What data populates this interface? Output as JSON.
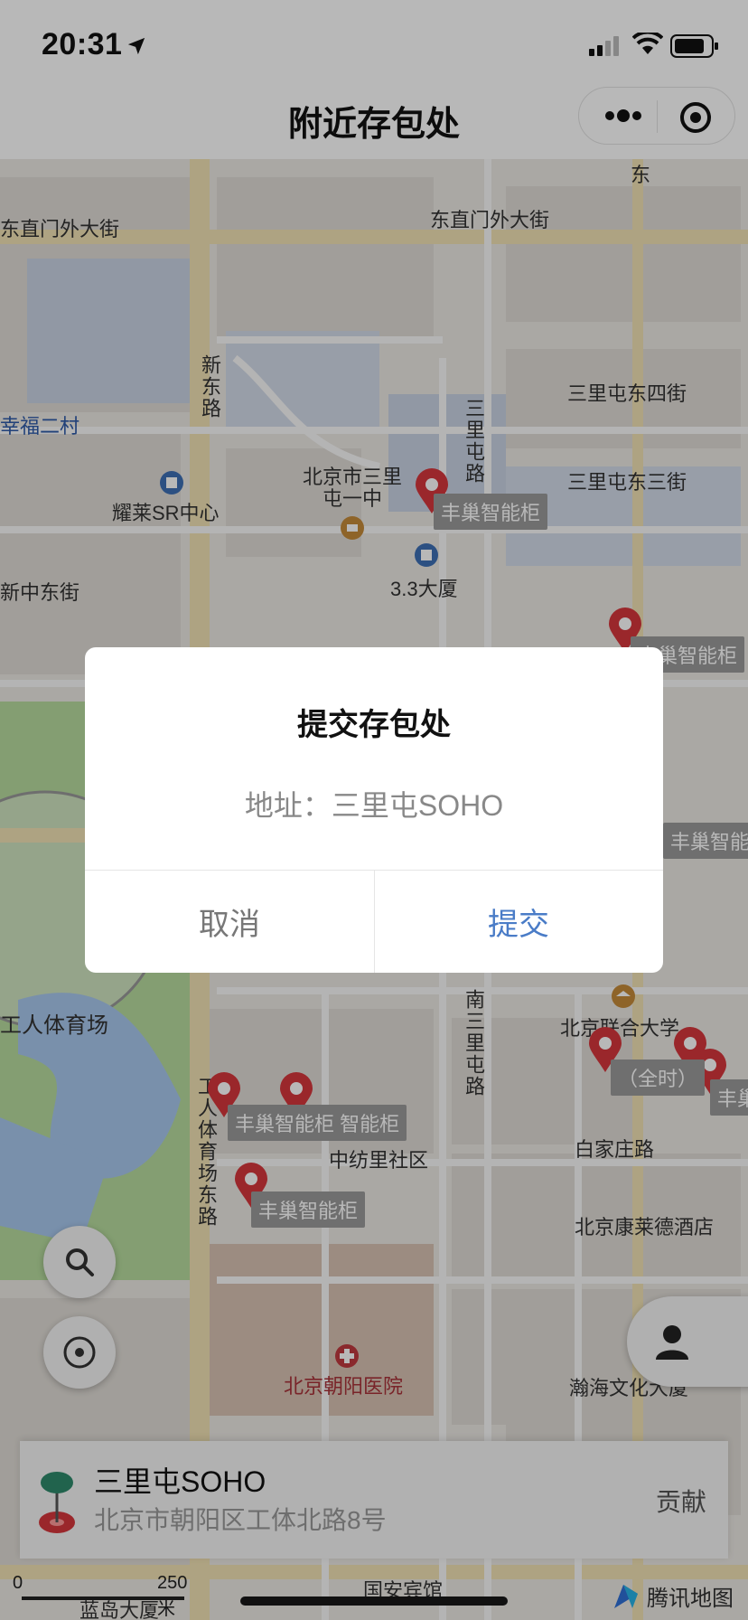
{
  "status_bar": {
    "time": "20:31"
  },
  "nav": {
    "title": "附近存包处"
  },
  "map": {
    "roads": [
      "东直门外大街",
      "东直门外大街",
      "新东路",
      "三里屯路",
      "三里屯东四街",
      "三里屯东三街",
      "新中东街",
      "幸福二村",
      "工人体育场",
      "工人体育场东路",
      "南三里屯路",
      "白家庄路",
      "东"
    ],
    "pois": [
      "耀莱SR中心",
      "北京市三里屯一中",
      "3.3大厦",
      "中纺里社区",
      "北京联合大学",
      "北京康莱德酒店",
      "北京朝阳医院",
      "瀚海文化大厦",
      "国安宾馆",
      "蓝岛大厦"
    ],
    "pin_tags": [
      "丰巢智能柜",
      "丰巢智能柜",
      "丰巢智能柜 智能柜",
      "丰巢智能柜",
      "丰巢智能",
      "（全时）",
      "丰巢"
    ]
  },
  "info_card": {
    "name": "三里屯SOHO",
    "address": "北京市朝阳区工体北路8号",
    "contribute": "贡献"
  },
  "scale": {
    "zero": "0",
    "distance": "250 米"
  },
  "watermark": "腾讯地图",
  "dialog": {
    "title": "提交存包处",
    "content": "地址：三里屯SOHO",
    "cancel": "取消",
    "confirm": "提交"
  },
  "colors": {
    "accent": "#4a7cc7",
    "pin_red": "#d6363c",
    "water": "#a8c8ee",
    "park": "#b7dc9e"
  }
}
